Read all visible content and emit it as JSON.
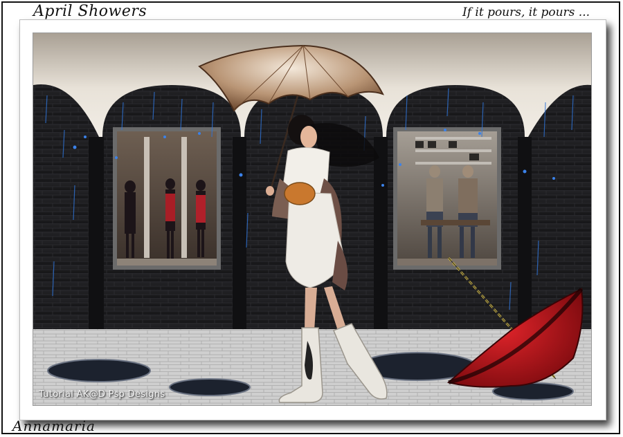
{
  "header": {
    "title_left": "April Showers",
    "title_right": "If it pours, it pours ..."
  },
  "footer": {
    "signature": "Annamaria"
  },
  "artwork": {
    "credit": "Tutorial AK@D Psp Designs"
  },
  "colors": {
    "wall": "#1c1c1e",
    "ceiling": "#cbc3b8",
    "floor": "#c9c9c9",
    "umbrella_open": "#b08d6e",
    "umbrella_red": "#c0141c",
    "raindrop": "#2f74d8"
  }
}
